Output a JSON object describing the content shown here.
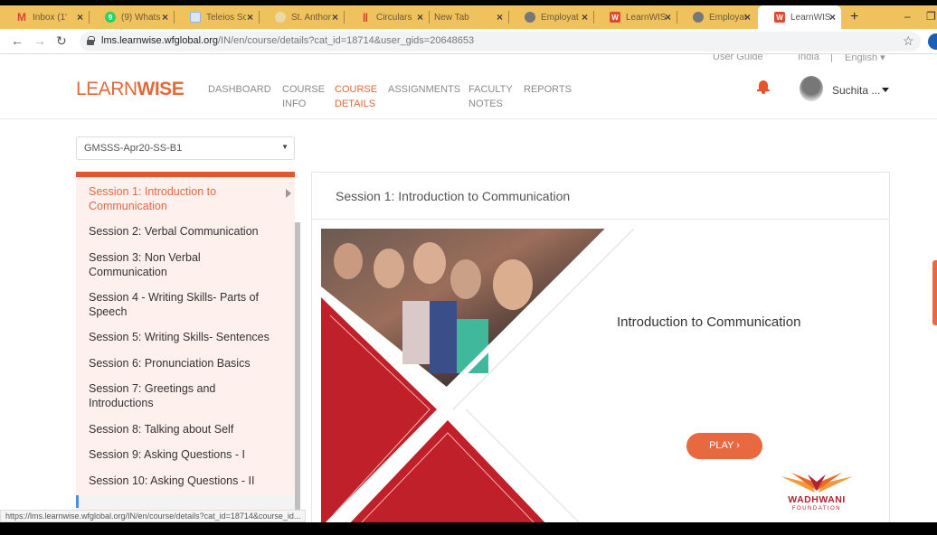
{
  "browser": {
    "tabs": [
      {
        "label": "Inbox (1'",
        "icon": "gmail-icon",
        "icon_color": "#d44638"
      },
      {
        "label": "(9) Whats",
        "icon": "whatsapp-icon",
        "icon_color": "#25d366",
        "icon_text": "9"
      },
      {
        "label": "Teleios Sc",
        "icon": "document-icon",
        "icon_color": "#8ab4f8"
      },
      {
        "label": "St. Anthor",
        "icon": "school-crest-icon",
        "icon_color": "#c8b27a"
      },
      {
        "label": "Circulars",
        "icon": "circulars-icon",
        "icon_color": "#d43a2a"
      },
      {
        "label": "New Tab",
        "icon": "",
        "icon_color": ""
      },
      {
        "label": "Employat",
        "icon": "globe-icon",
        "icon_color": "#666666"
      },
      {
        "label": "LearnWIS",
        "icon": "learnwise-icon",
        "icon_color": "#e04a2f",
        "icon_text": "W"
      },
      {
        "label": "Employat",
        "icon": "globe-icon",
        "icon_color": "#666666"
      },
      {
        "label": "LearnWIS",
        "icon": "learnwise-icon",
        "icon_color": "#e04a2f",
        "icon_text": "W",
        "active": true
      }
    ],
    "new_tab_label": "+",
    "minimize_label": "–",
    "restore_label": "❐",
    "url_host": "lms.learnwise.wfglobal.org",
    "url_path": "/IN/en/course/details?cat_id=18714&user_gids=20648653",
    "status_url": "https://lms.learnwise.wfglobal.org/IN/en/course/details?cat_id=18714&course_id..."
  },
  "header": {
    "utility": {
      "user_guide": "User Guide",
      "country": "India",
      "separator": "|",
      "language": "English ▾"
    },
    "logo": {
      "thin": "LEARN",
      "bold": "WISE"
    },
    "nav": [
      {
        "line1": "DASHBOARD",
        "line2": ""
      },
      {
        "line1": "COURSE",
        "line2": "INFO"
      },
      {
        "line1": "COURSE",
        "line2": "DETAILS",
        "active": true
      },
      {
        "line1": "ASSIGNMENTS",
        "line2": ""
      },
      {
        "line1": "FACULTY",
        "line2": "NOTES"
      },
      {
        "line1": "REPORTS",
        "line2": ""
      }
    ],
    "user_name": "Suchita ..."
  },
  "batch_select": {
    "value": "GMSSS-Apr20-SS-B1",
    "arrow": "▼"
  },
  "sessions": [
    {
      "label": "Session 1: Introduction to Communication",
      "active": true
    },
    {
      "label": "Session 2: Verbal Communication"
    },
    {
      "label": "Session 3: Non Verbal Communication"
    },
    {
      "label": "Session 4 - Writing Skills- Parts of Speech"
    },
    {
      "label": "Session 5: Writing Skills- Sentences"
    },
    {
      "label": "Session 6: Pronunciation Basics"
    },
    {
      "label": "Session 7: Greetings and Introductions"
    },
    {
      "label": "Session 8: Talking about Self"
    },
    {
      "label": "Session 9: Asking Questions - I"
    },
    {
      "label": "Session 10: Asking Questions - II"
    }
  ],
  "content": {
    "panel_title": "Session 1: Introduction to Communication",
    "slide_title": "Introduction to Communication",
    "play_label": "PLAY ›",
    "foundation_name": "WADHWANI",
    "foundation_sub": "FOUNDATION"
  },
  "colors": {
    "brand": "#e06a3a",
    "accent_bar": "#e4562f",
    "slide_red": "#c0202a",
    "tabstrip": "#efc25d"
  }
}
